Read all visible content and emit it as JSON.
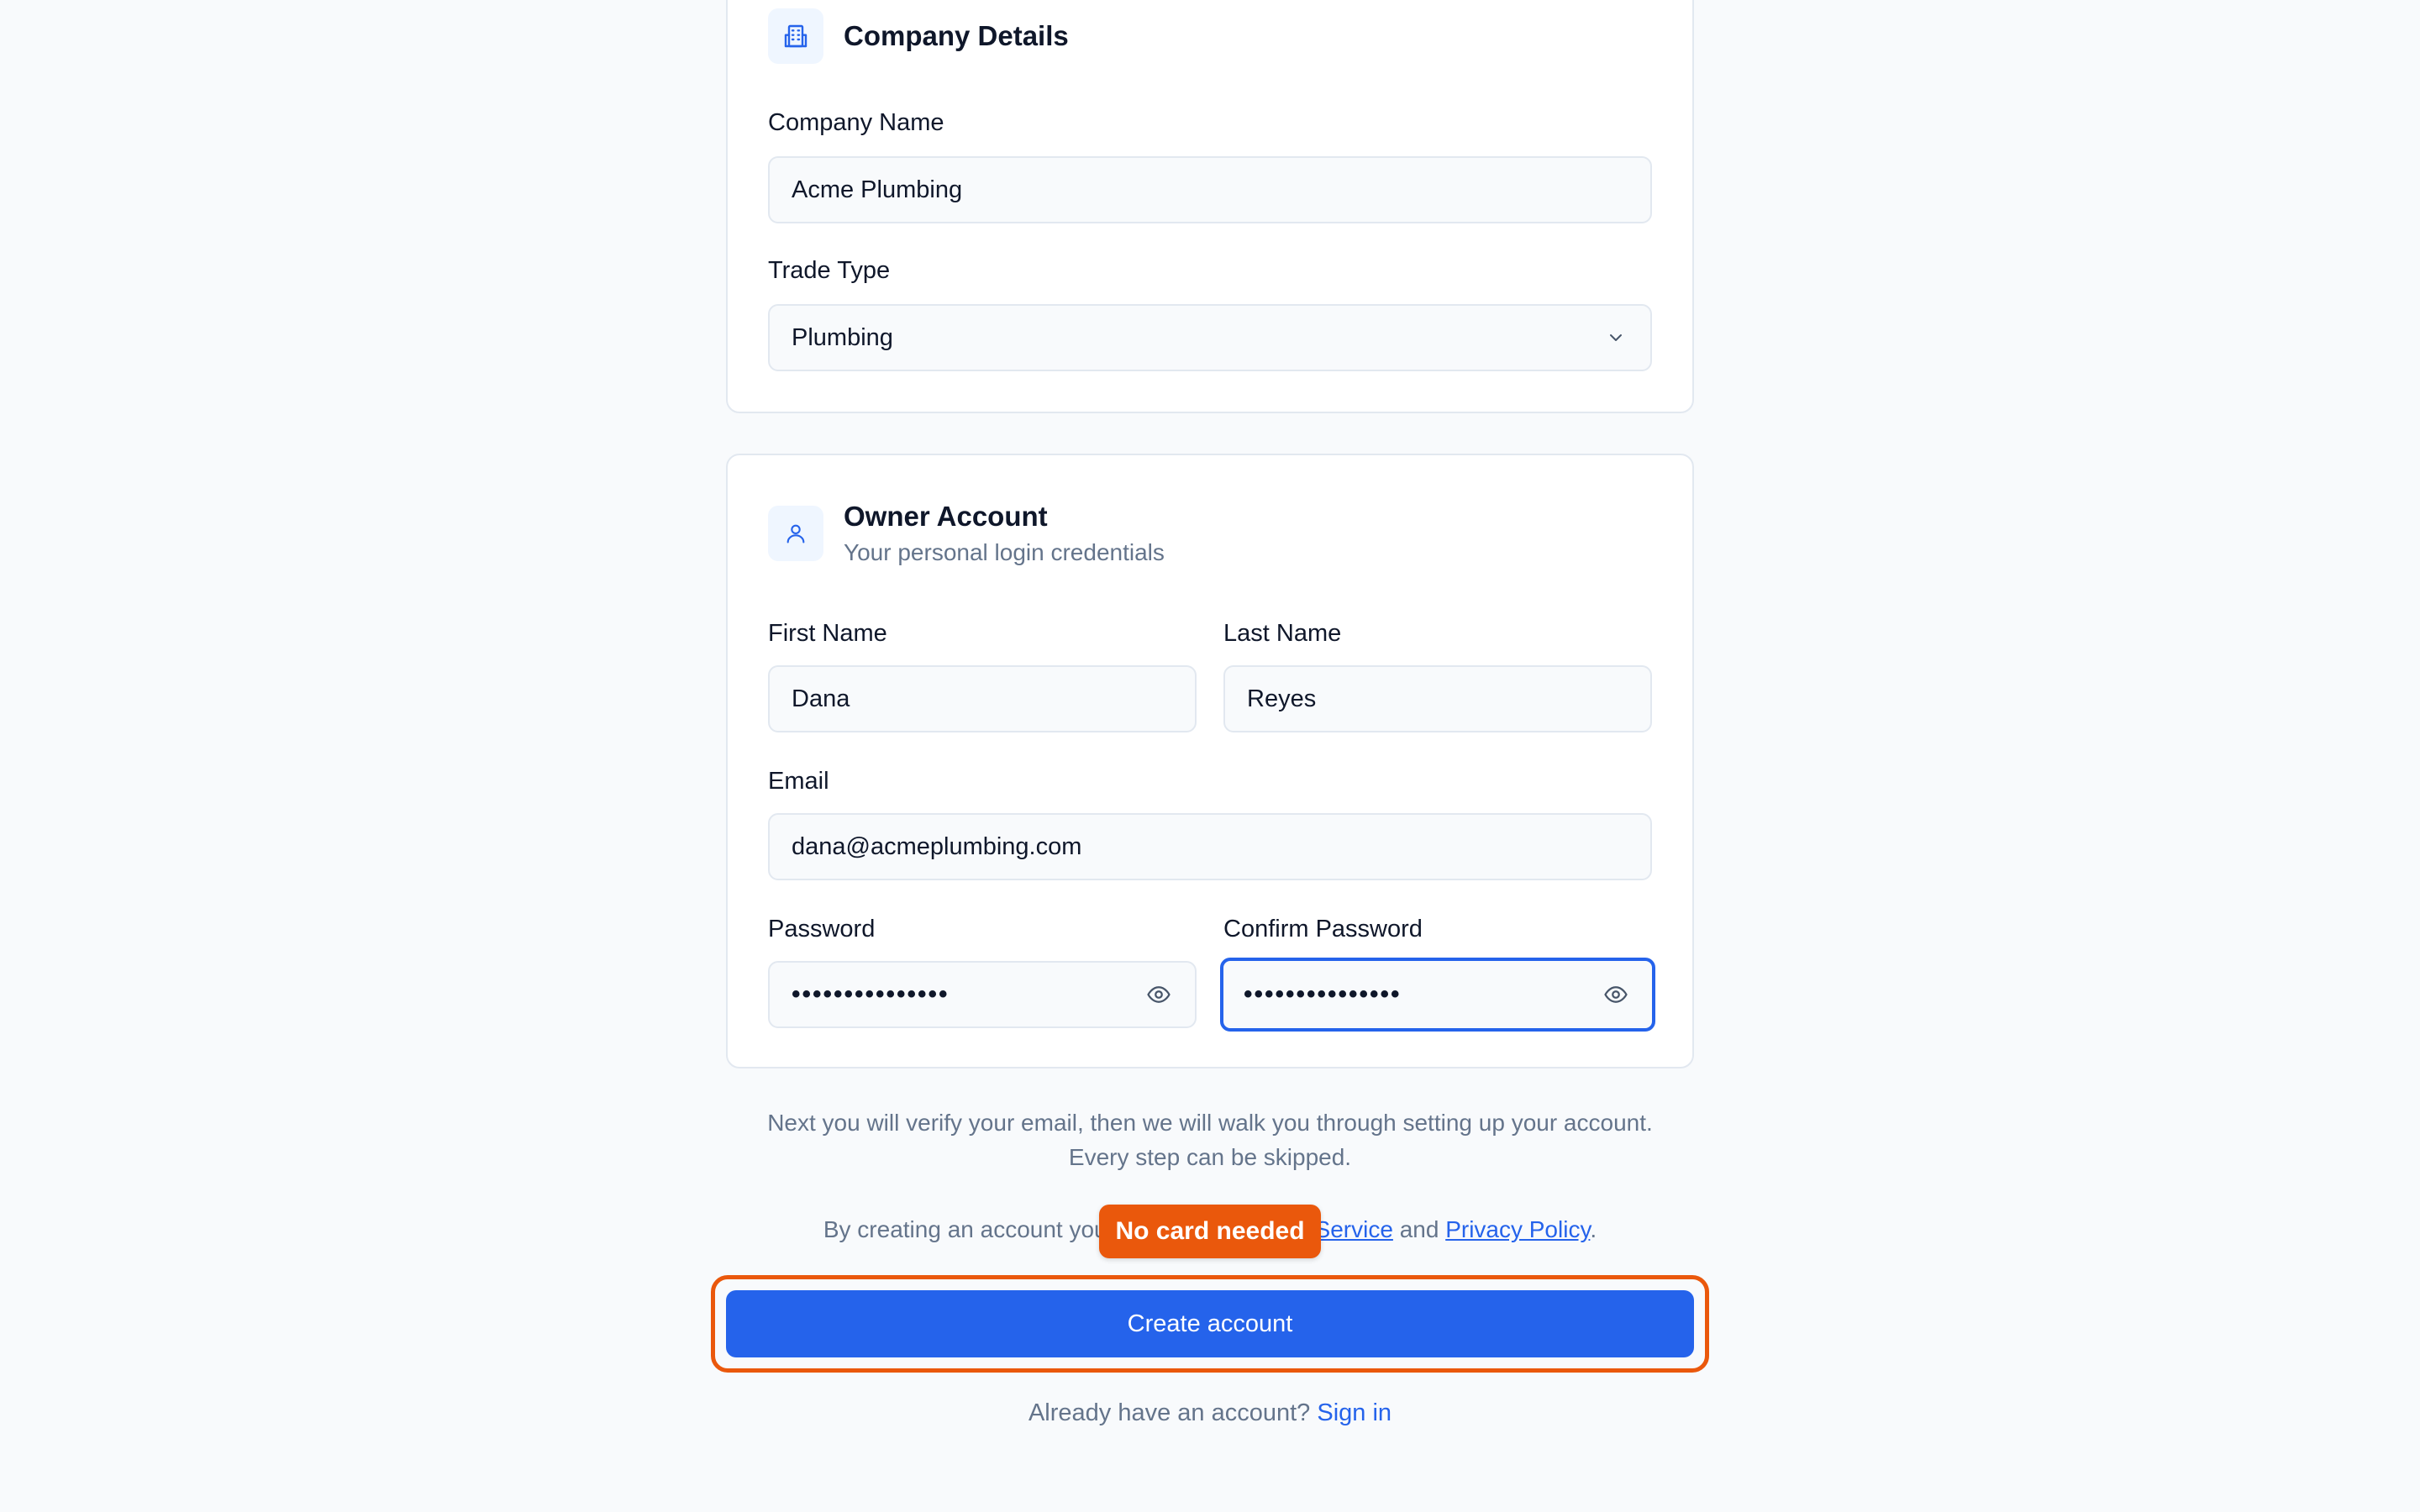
{
  "company_section": {
    "title": "Company Details",
    "icon": "building-icon",
    "company_name": {
      "label": "Company Name",
      "value": "Acme Plumbing"
    },
    "trade_type": {
      "label": "Trade Type",
      "value": "Plumbing"
    }
  },
  "owner_section": {
    "title": "Owner Account",
    "subtitle": "Your personal login credentials",
    "icon": "user-icon",
    "first_name": {
      "label": "First Name",
      "value": "Dana"
    },
    "last_name": {
      "label": "Last Name",
      "value": "Reyes"
    },
    "email": {
      "label": "Email",
      "value": "dana@acmeplumbing.com"
    },
    "password": {
      "label": "Password",
      "value": "•••••••••••••••"
    },
    "confirm_password": {
      "label": "Confirm Password",
      "value": "•••••••••••••••"
    }
  },
  "info": {
    "line1": "Next you will verify your email, then we will walk you through setting up your account.",
    "line2": "Every step can be skipped."
  },
  "terms": {
    "prefix": "By creating an account you a",
    "terms_link": "f Service",
    "middle": "and",
    "privacy_link": "Privacy Policy",
    "suffix": "."
  },
  "badge": {
    "text": "No card needed"
  },
  "create_button": {
    "label": "Create account"
  },
  "signin": {
    "prompt": "Already have an account?",
    "link": "Sign in"
  },
  "colors": {
    "primary": "#2563eb",
    "accent": "#ea580c",
    "background": "#f8fafc",
    "muted_text": "#64748b"
  }
}
